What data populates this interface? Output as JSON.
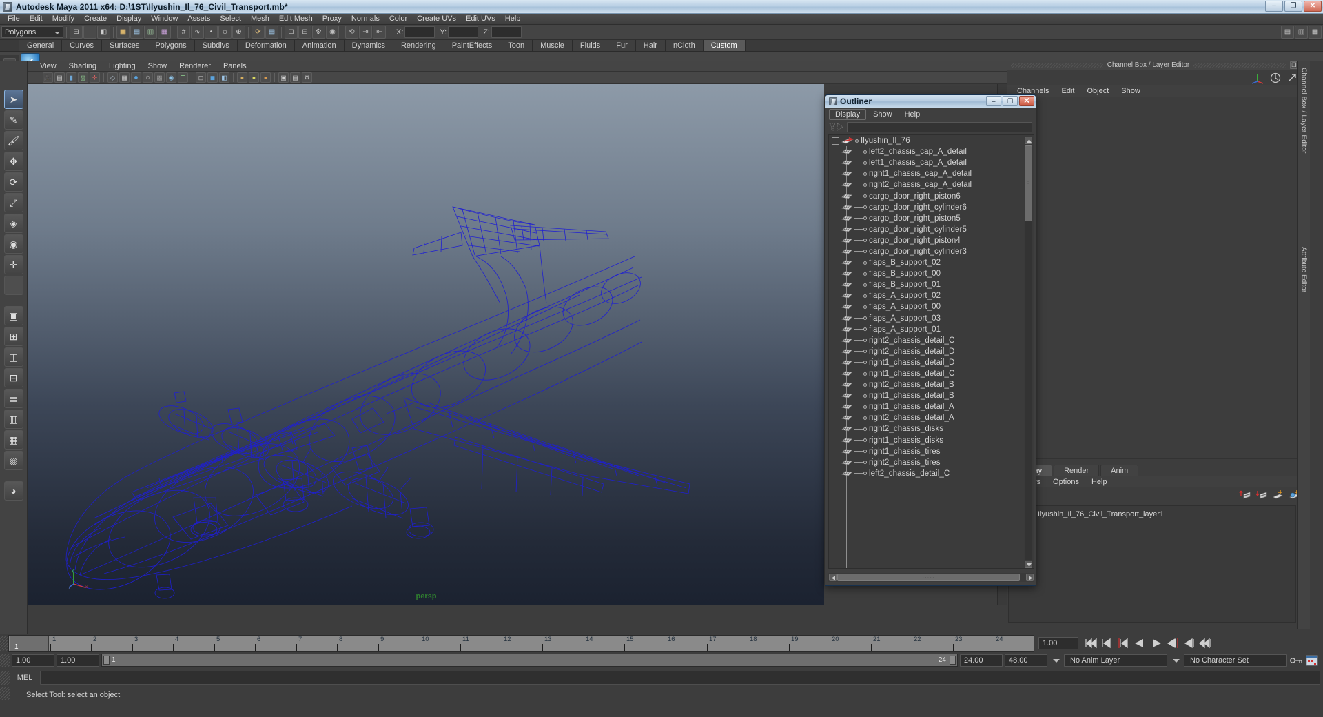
{
  "window": {
    "title": "Autodesk Maya 2011 x64: D:\\1ST\\Ilyushin_Il_76_Civil_Transport.mb*",
    "minimize": "–",
    "maximize": "❐",
    "close": "✕",
    "icon": "maya-app-icon"
  },
  "menubar": {
    "items": [
      "File",
      "Edit",
      "Modify",
      "Create",
      "Display",
      "Window",
      "Assets",
      "Select",
      "Mesh",
      "Edit Mesh",
      "Proxy",
      "Normals",
      "Color",
      "Create UVs",
      "Edit UVs",
      "Help"
    ]
  },
  "statusbar": {
    "selection_mode": "Polygons",
    "axis_labels": [
      "X:",
      "Y:",
      "Z:"
    ],
    "field_values": [
      "",
      "",
      ""
    ]
  },
  "shelf": {
    "tabs": [
      "General",
      "Curves",
      "Surfaces",
      "Polygons",
      "Subdivs",
      "Deformation",
      "Animation",
      "Dynamics",
      "Rendering",
      "PaintEffects",
      "Toon",
      "Muscle",
      "Fluids",
      "Fur",
      "Hair",
      "nCloth",
      "Custom"
    ],
    "active_tab": "Custom",
    "buttons": [
      {
        "name": "check-icon",
        "label": "✓"
      }
    ]
  },
  "viewport": {
    "menus": [
      "View",
      "Shading",
      "Lighting",
      "Show",
      "Renderer",
      "Panels"
    ],
    "camera_label": "persp",
    "axis_labels": {
      "x": "x",
      "y": "y",
      "z": "z"
    }
  },
  "outliner": {
    "title": "Outliner",
    "window_buttons": {
      "minimize": "–",
      "maximize": "❐",
      "close": "✕"
    },
    "menus": [
      "Display",
      "Show",
      "Help"
    ],
    "search_value": "",
    "root": "Ilyushin_Il_76",
    "items": [
      "left2_chassis_cap_A_detail",
      "left1_chassis_cap_A_detail",
      "right1_chassis_cap_A_detail",
      "right2_chassis_cap_A_detail",
      "cargo_door_right_piston6",
      "cargo_door_right_cylinder6",
      "cargo_door_right_piston5",
      "cargo_door_right_cylinder5",
      "cargo_door_right_piston4",
      "cargo_door_right_cylinder3",
      "flaps_B_support_02",
      "flaps_B_support_00",
      "flaps_B_support_01",
      "flaps_A_support_02",
      "flaps_A_support_00",
      "flaps_A_support_03",
      "flaps_A_support_01",
      "right2_chassis_detail_C",
      "right2_chassis_detail_D",
      "right1_chassis_detail_D",
      "right1_chassis_detail_C",
      "right2_chassis_detail_B",
      "right1_chassis_detail_B",
      "right1_chassis_detail_A",
      "right2_chassis_detail_A",
      "right2_chassis_disks",
      "right1_chassis_disks",
      "right1_chassis_tires",
      "right2_chassis_tires",
      "left2_chassis_detail_C"
    ]
  },
  "channelbox": {
    "dock_title": "Channel Box / Layer Editor",
    "dock_buttons": {
      "float": "❐",
      "close": "✕"
    },
    "menus": [
      "Channels",
      "Edit",
      "Object",
      "Show"
    ],
    "rail_labels": [
      "Channel Box / Layer Editor",
      "Attribute Editor"
    ]
  },
  "layer_editor": {
    "tabs": [
      "Display",
      "Render",
      "Anim"
    ],
    "active_tab": "Display",
    "menus": [
      "Layers",
      "Options",
      "Help"
    ],
    "layers": [
      {
        "name": "Ilyushin_Il_76_Civil_Transport_layer1",
        "visible": true
      }
    ]
  },
  "timeline": {
    "ticks": [
      "1",
      "2",
      "3",
      "4",
      "5",
      "6",
      "7",
      "8",
      "9",
      "10",
      "11",
      "12",
      "13",
      "14",
      "15",
      "16",
      "17",
      "18",
      "19",
      "20",
      "21",
      "22",
      "23",
      "24"
    ],
    "current_frame": "1",
    "current_frame_field": "1.00",
    "playback_buttons": [
      "go-to-start",
      "step-back-key",
      "step-back-frame",
      "play-backwards",
      "play-forwards",
      "step-forward-frame",
      "step-forward-key",
      "go-to-end"
    ]
  },
  "range": {
    "start": "1.00",
    "end": "1.00",
    "range_start_label": "1",
    "range_end_label": "24",
    "playback_end": "24.00",
    "anim_end": "48.00",
    "anim_layer": "No Anim Layer",
    "character_set": "No Character Set"
  },
  "command": {
    "label": "MEL",
    "value": "",
    "status_message": "Select Tool: select an object"
  },
  "colors": {
    "wireframe": "#1414c8",
    "accent": "#5d7fa6",
    "persp_label": "#2f7d2f"
  }
}
